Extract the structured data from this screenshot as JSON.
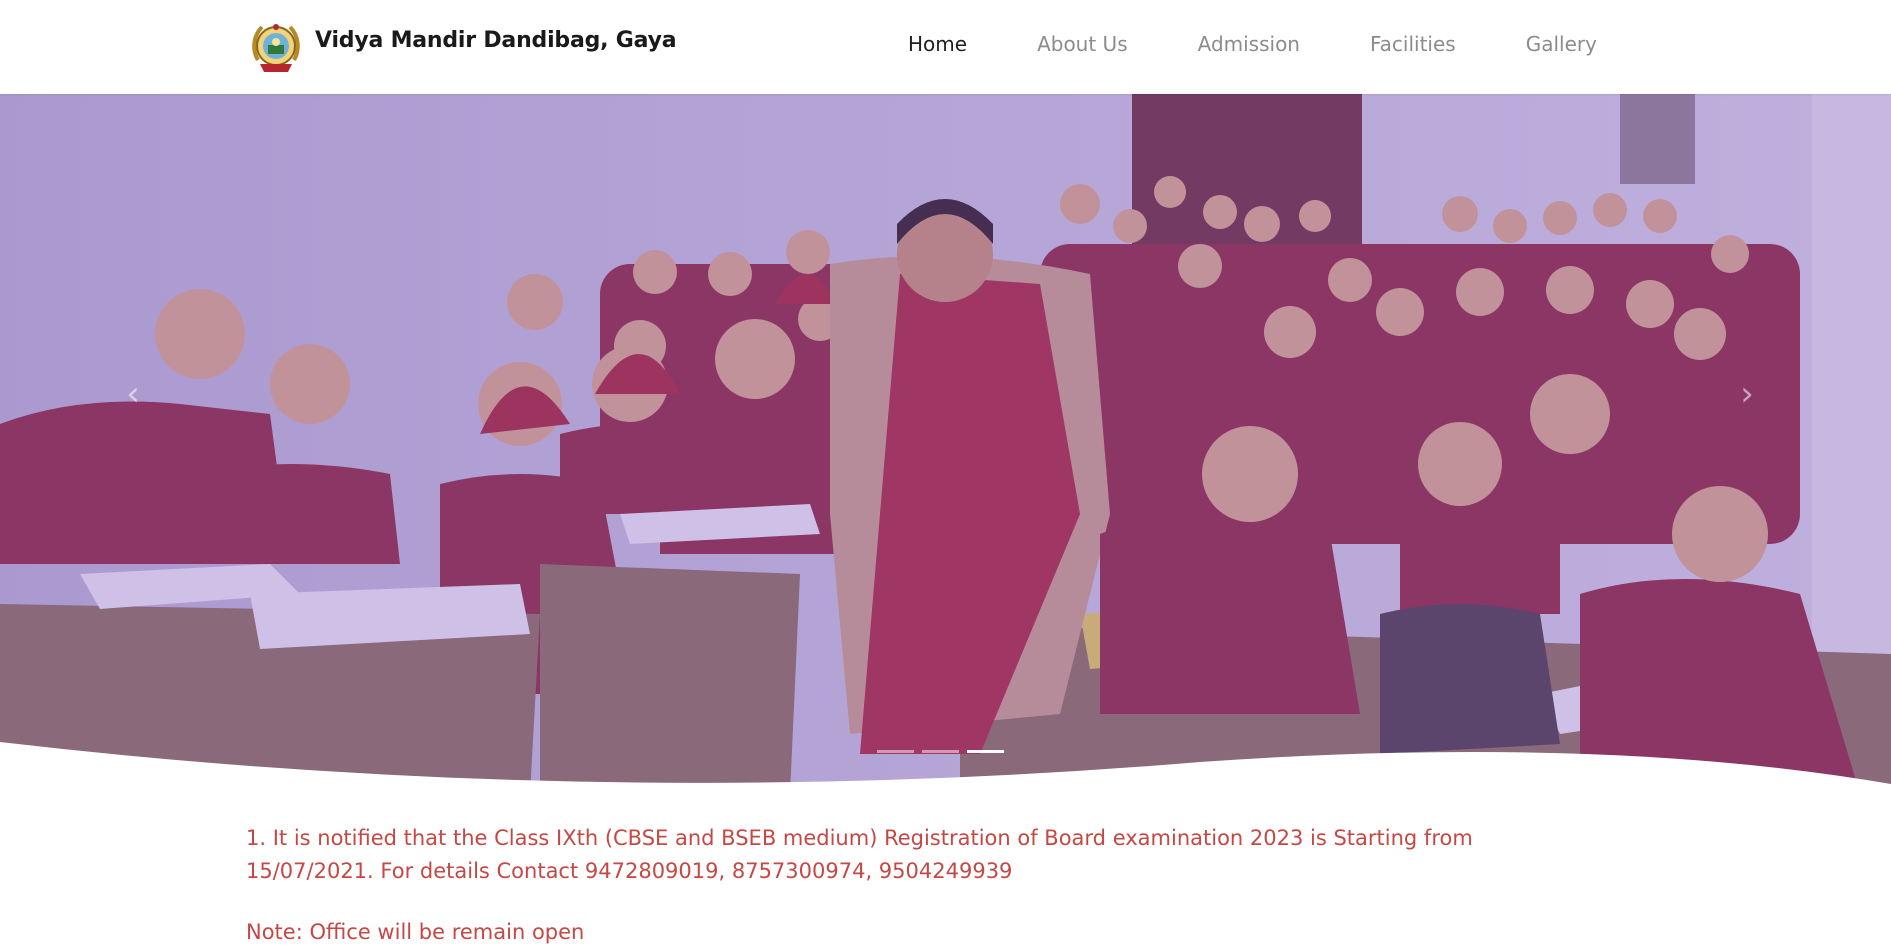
{
  "header": {
    "school_name": "Vidya Mandir Dandibag, Gaya",
    "logo_icon": "school-crest-icon"
  },
  "nav": {
    "items": [
      {
        "label": "Home",
        "active": true
      },
      {
        "label": "About Us",
        "active": false
      },
      {
        "label": "Admission",
        "active": false
      },
      {
        "label": "Facilities",
        "active": false
      },
      {
        "label": "Gallery",
        "active": false
      }
    ]
  },
  "carousel": {
    "prev_icon": "chevron-left-icon",
    "next_icon": "chevron-right-icon",
    "slide_count": 3,
    "active_slide": 3,
    "overlay_color": "#8a64c8"
  },
  "notice": {
    "line1": "1. It is notified that the Class IXth (CBSE and BSEB medium) Registration of Board examination 2023 is Starting from 15/07/2021. For details Contact 9472809019, 8757300974, 9504249939",
    "line2": "Note: Office will be remain open",
    "color": "#c54844"
  }
}
